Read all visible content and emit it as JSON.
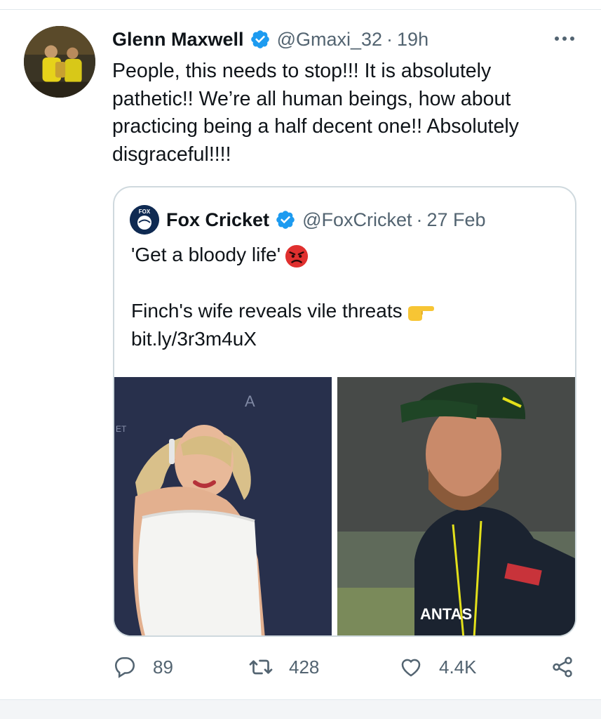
{
  "tweet": {
    "author_name": "Glenn Maxwell",
    "author_handle": "@Gmaxi_32",
    "separator": "·",
    "time": "19h",
    "text": "People, this needs to stop!!! It is absolutely pathetic!! We’re all human beings, how about practicing being a half decent one!! Absolutely disgraceful!!!!",
    "verified": true
  },
  "quote": {
    "author_name": "Fox Cricket",
    "author_handle": "@FoxCricket",
    "separator": "·",
    "time": "27 Feb",
    "logo_text": "FOX",
    "line1": "'Get a bloody life'",
    "line1_emoji": "angry-face-emoji",
    "line2": "Finch's wife reveals vile threats",
    "line2_emoji": "pointing-right-emoji",
    "link": "bit.ly/3r3m4uX",
    "verified": true,
    "images": [
      "woman-white-dress-photo",
      "cricketer-cap-photo"
    ],
    "photo_text": {
      "backdrop_left": "ET",
      "backdrop_mid": "A",
      "shirt_sponsor": "ANTAS"
    }
  },
  "actions": {
    "reply_count": "89",
    "retweet_count": "428",
    "like_count": "4.4K",
    "icons": [
      "reply-icon",
      "retweet-icon",
      "like-icon",
      "share-icon"
    ]
  },
  "colors": {
    "text_primary": "#0f1419",
    "text_secondary": "#536471",
    "verified_blue": "#1d9bf0",
    "border": "#cfd9de"
  }
}
